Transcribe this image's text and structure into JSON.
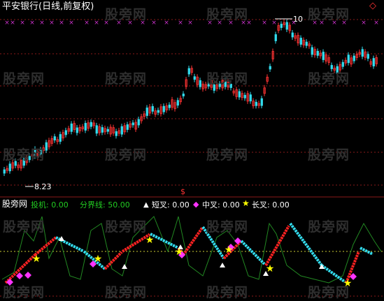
{
  "window": {
    "title": "平安银行(日线,前复权)",
    "corner_icon": "diamond-outline-icon",
    "watermark": "股旁网"
  },
  "price_panel": {
    "high_label": "10",
    "low_label": "8.23",
    "marker_symbol": "×",
    "marker_color": "#cc33cc"
  },
  "separator": {
    "symbol": "$",
    "color": "#ff3333"
  },
  "indicator_header": {
    "source": "股旁网",
    "items": [
      {
        "label": "投机: 0.00",
        "color": "#22cc22",
        "icon": ""
      },
      {
        "label": "分界线: 50.00",
        "color": "#22cc22",
        "icon": ""
      },
      {
        "label": "短叉: 0.00",
        "color": "#ffffff",
        "icon": "triangle-icon"
      },
      {
        "label": "中叉: 0.00",
        "color": "#ffffff",
        "icon": "diamond-icon"
      },
      {
        "label": "长叉: 0.00",
        "color": "#ffffff",
        "icon": "star-icon"
      }
    ]
  },
  "colors": {
    "up_candle": "#ff3333",
    "down_candle": "#33ddee",
    "grid": "#8b1a1a",
    "rising_line": "#ff2222",
    "falling_line": "#33ddee",
    "thin_line": "#228822",
    "reference_line": "#cccc33",
    "triangle": "#ffffff",
    "diamond": "#ff33ff",
    "star": "#ffff00"
  }
}
